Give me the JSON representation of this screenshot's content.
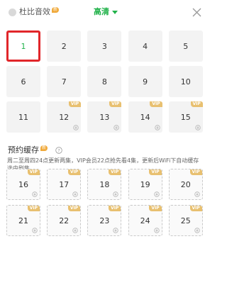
{
  "header": {
    "dolby_label": "杜比音效",
    "dolby_badge": "新",
    "quality_label": "高清"
  },
  "episodes": [
    {
      "num": "1",
      "vip": false,
      "selected": true
    },
    {
      "num": "2",
      "vip": false
    },
    {
      "num": "3",
      "vip": false
    },
    {
      "num": "4",
      "vip": false
    },
    {
      "num": "5",
      "vip": false
    },
    {
      "num": "6",
      "vip": false
    },
    {
      "num": "7",
      "vip": false
    },
    {
      "num": "8",
      "vip": false
    },
    {
      "num": "9",
      "vip": false
    },
    {
      "num": "10",
      "vip": false
    },
    {
      "num": "11",
      "vip": false
    },
    {
      "num": "12",
      "vip": true
    },
    {
      "num": "13",
      "vip": true
    },
    {
      "num": "14",
      "vip": true
    },
    {
      "num": "15",
      "vip": true
    }
  ],
  "reserve": {
    "title": "预约缓存",
    "badge": "新",
    "description": "周二至周四24点更新两集，VIP会员22点抢先看4集，更新后WiFi下自动缓存选中剧集",
    "episodes": [
      {
        "num": "16",
        "vip": true
      },
      {
        "num": "17",
        "vip": true
      },
      {
        "num": "18",
        "vip": true
      },
      {
        "num": "19",
        "vip": true
      },
      {
        "num": "20",
        "vip": true
      },
      {
        "num": "21",
        "vip": true
      },
      {
        "num": "22",
        "vip": true
      },
      {
        "num": "23",
        "vip": true
      },
      {
        "num": "24",
        "vip": true
      },
      {
        "num": "25",
        "vip": true
      }
    ]
  },
  "vip_label": "VIP",
  "colors": {
    "accent": "#21b24a",
    "selected_border": "#e1262a",
    "vip_badge": "#e8c070"
  }
}
